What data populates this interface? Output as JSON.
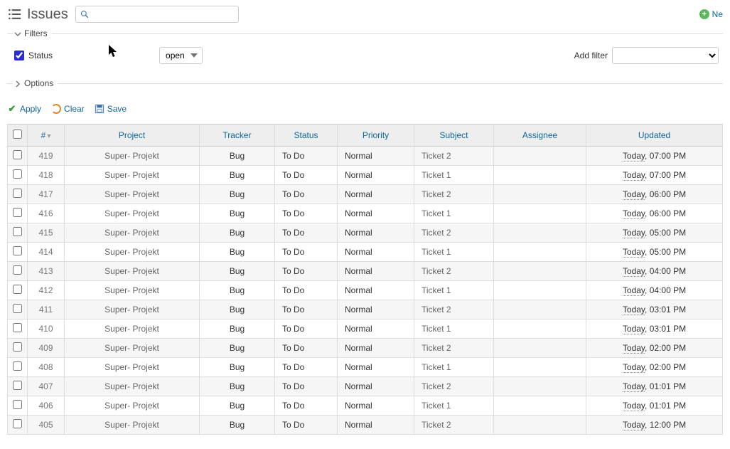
{
  "header": {
    "title": "Issues",
    "new_label": "Ne"
  },
  "search": {
    "placeholder": ""
  },
  "filters": {
    "legend": "Filters",
    "status_label": "Status",
    "status_checked": true,
    "status_operator": "open",
    "add_filter_label": "Add filter"
  },
  "options": {
    "legend": "Options"
  },
  "actions": {
    "apply": "Apply",
    "clear": "Clear",
    "save": "Save"
  },
  "table": {
    "columns": {
      "id": "#",
      "project": "Project",
      "tracker": "Tracker",
      "status": "Status",
      "priority": "Priority",
      "subject": "Subject",
      "assignee": "Assignee",
      "updated": "Updated"
    },
    "rows": [
      {
        "id": "419",
        "project": "Super- Projekt",
        "tracker": "Bug",
        "status": "To Do",
        "priority": "Normal",
        "subject": "Ticket 2",
        "assignee": "",
        "updated_prefix": "Today",
        "updated_rest": ", 07:00 PM"
      },
      {
        "id": "418",
        "project": "Super- Projekt",
        "tracker": "Bug",
        "status": "To Do",
        "priority": "Normal",
        "subject": "Ticket 1",
        "assignee": "",
        "updated_prefix": "Today",
        "updated_rest": ", 07:00 PM"
      },
      {
        "id": "417",
        "project": "Super- Projekt",
        "tracker": "Bug",
        "status": "To Do",
        "priority": "Normal",
        "subject": "Ticket 2",
        "assignee": "",
        "updated_prefix": "Today",
        "updated_rest": ", 06:00 PM"
      },
      {
        "id": "416",
        "project": "Super- Projekt",
        "tracker": "Bug",
        "status": "To Do",
        "priority": "Normal",
        "subject": "Ticket 1",
        "assignee": "",
        "updated_prefix": "Today",
        "updated_rest": ", 06:00 PM"
      },
      {
        "id": "415",
        "project": "Super- Projekt",
        "tracker": "Bug",
        "status": "To Do",
        "priority": "Normal",
        "subject": "Ticket 2",
        "assignee": "",
        "updated_prefix": "Today",
        "updated_rest": ", 05:00 PM"
      },
      {
        "id": "414",
        "project": "Super- Projekt",
        "tracker": "Bug",
        "status": "To Do",
        "priority": "Normal",
        "subject": "Ticket 1",
        "assignee": "",
        "updated_prefix": "Today",
        "updated_rest": ", 05:00 PM"
      },
      {
        "id": "413",
        "project": "Super- Projekt",
        "tracker": "Bug",
        "status": "To Do",
        "priority": "Normal",
        "subject": "Ticket 2",
        "assignee": "",
        "updated_prefix": "Today",
        "updated_rest": ", 04:00 PM"
      },
      {
        "id": "412",
        "project": "Super- Projekt",
        "tracker": "Bug",
        "status": "To Do",
        "priority": "Normal",
        "subject": "Ticket 1",
        "assignee": "",
        "updated_prefix": "Today",
        "updated_rest": ", 04:00 PM"
      },
      {
        "id": "411",
        "project": "Super- Projekt",
        "tracker": "Bug",
        "status": "To Do",
        "priority": "Normal",
        "subject": "Ticket 2",
        "assignee": "",
        "updated_prefix": "Today",
        "updated_rest": ", 03:01 PM"
      },
      {
        "id": "410",
        "project": "Super- Projekt",
        "tracker": "Bug",
        "status": "To Do",
        "priority": "Normal",
        "subject": "Ticket 1",
        "assignee": "",
        "updated_prefix": "Today",
        "updated_rest": ", 03:01 PM"
      },
      {
        "id": "409",
        "project": "Super- Projekt",
        "tracker": "Bug",
        "status": "To Do",
        "priority": "Normal",
        "subject": "Ticket 2",
        "assignee": "",
        "updated_prefix": "Today",
        "updated_rest": ", 02:00 PM"
      },
      {
        "id": "408",
        "project": "Super- Projekt",
        "tracker": "Bug",
        "status": "To Do",
        "priority": "Normal",
        "subject": "Ticket 1",
        "assignee": "",
        "updated_prefix": "Today",
        "updated_rest": ", 02:00 PM"
      },
      {
        "id": "407",
        "project": "Super- Projekt",
        "tracker": "Bug",
        "status": "To Do",
        "priority": "Normal",
        "subject": "Ticket 2",
        "assignee": "",
        "updated_prefix": "Today",
        "updated_rest": ", 01:01 PM"
      },
      {
        "id": "406",
        "project": "Super- Projekt",
        "tracker": "Bug",
        "status": "To Do",
        "priority": "Normal",
        "subject": "Ticket 1",
        "assignee": "",
        "updated_prefix": "Today",
        "updated_rest": ", 01:01 PM"
      },
      {
        "id": "405",
        "project": "Super- Projekt",
        "tracker": "Bug",
        "status": "To Do",
        "priority": "Normal",
        "subject": "Ticket 2",
        "assignee": "",
        "updated_prefix": "Today",
        "updated_rest": ", 12:00 PM"
      }
    ]
  }
}
